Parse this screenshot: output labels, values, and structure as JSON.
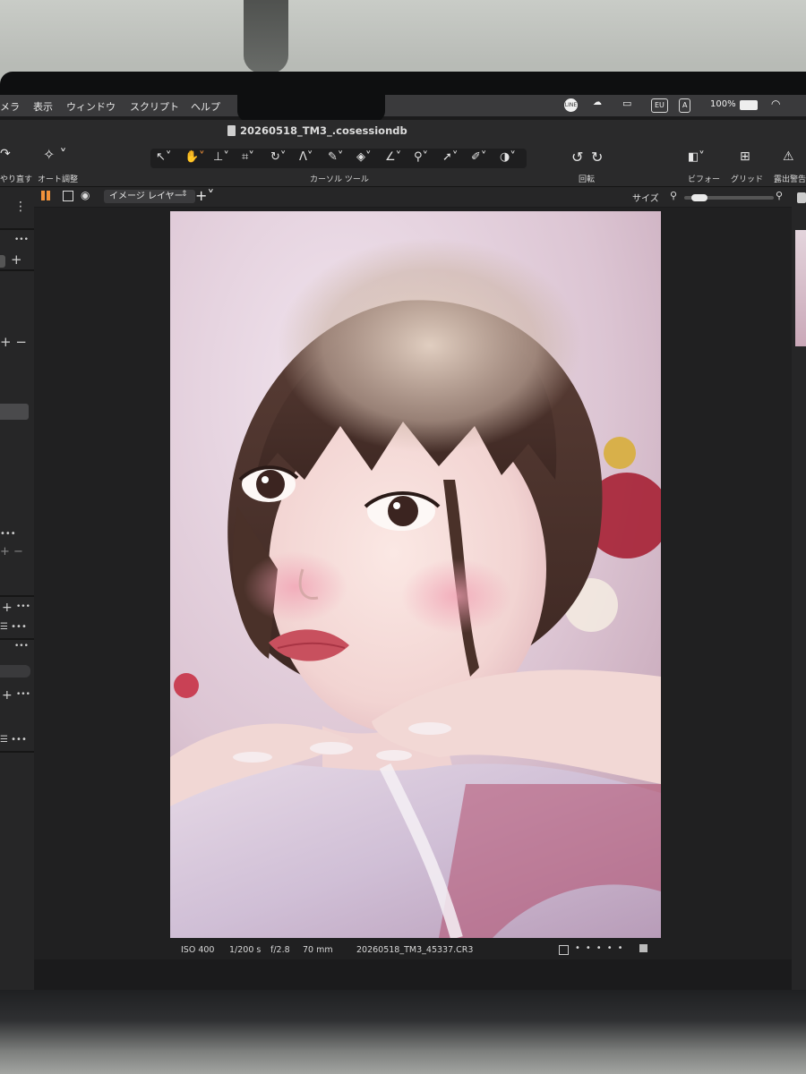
{
  "menubar": {
    "menus": [
      "メラ",
      "表示",
      "ウィンドウ",
      "スクリプト",
      "ヘルプ"
    ],
    "status_badges": [
      "EU",
      "A"
    ],
    "battery": "100%"
  },
  "document": {
    "title": "20260518_TM3_.cosessiondb"
  },
  "toolbar": {
    "redo_label": "やり直す",
    "auto_adjust_label": "オート調整",
    "cursor_tools_label": "カーソル ツール",
    "rotate_label": "回転",
    "before_label": "ビフォー",
    "grid_label": "グリッド",
    "exposure_warning_label": "露出警告"
  },
  "viewer_header": {
    "layer_select": "イメージ レイヤー",
    "size_label": "サイズ",
    "zoom_fraction": 0.1
  },
  "info": {
    "iso": "ISO 400",
    "shutter": "1/200 s",
    "aperture": "f/2.8",
    "focal_length": "70 mm",
    "filename": "20260518_TM3_45337.CR3"
  },
  "colors": {
    "accent": "#f0913a",
    "panel": "#262627",
    "viewer": "#202021",
    "lip": "#c8505e",
    "hair": "#4a3129"
  }
}
